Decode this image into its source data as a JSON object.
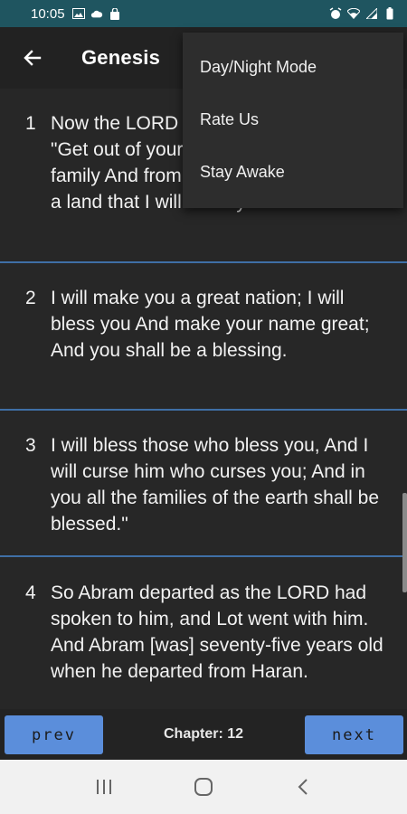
{
  "status_bar": {
    "time": "10:05",
    "left_icons": [
      "gallery-icon",
      "cloud-icon",
      "bag-icon"
    ],
    "right_icons": [
      "alarm-icon",
      "wifi-icon",
      "signal-icon",
      "battery-icon"
    ],
    "color": "#1f5560"
  },
  "app_bar": {
    "back_icon": "arrow-left-icon",
    "title": "Genesis"
  },
  "verses": [
    {
      "number": "1",
      "text": "Now the LORD had said to Abram: \"Get out of your country, From your family And from your father's house, To a land that I will show you."
    },
    {
      "number": "2",
      "text": "I will make you a great nation; I will bless you And make your name great; And you shall be a blessing."
    },
    {
      "number": "3",
      "text": "I will bless those who bless you, And I will curse him who curses you; And in you all the families of the earth shall be blessed.\""
    },
    {
      "number": "4",
      "text": "So Abram departed as the LORD had spoken to him, and Lot went with him. And Abram [was] seventy-five years old when he departed from Haran."
    }
  ],
  "menu": {
    "items": [
      "Day/Night Mode",
      "Rate Us",
      "Stay Awake"
    ]
  },
  "bottom_bar": {
    "prev_label": "prev",
    "next_label": "next",
    "chapter_label": "Chapter: 12",
    "button_color": "#5b8edb"
  },
  "system_nav": {
    "keys": [
      "recents-icon",
      "home-icon",
      "back-icon"
    ]
  }
}
